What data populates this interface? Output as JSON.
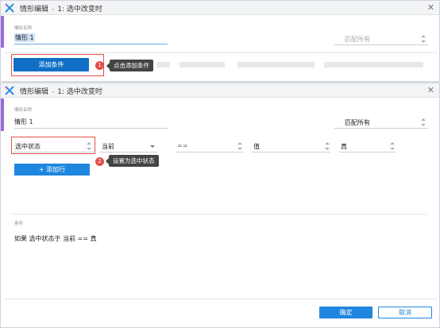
{
  "dialog1": {
    "title": "情形编辑",
    "title_sep": "-",
    "title_case": "1: 选中改变时",
    "name_label": "情形名称",
    "name_value": "情形 1",
    "match_value": "匹配所有",
    "add_condition_label": "添加条件",
    "step_badge": "1",
    "tooltip": "点击添加条件",
    "close_glyph": "✕"
  },
  "dialog2": {
    "title": "情形编辑",
    "title_sep": "-",
    "title_case": "1: 选中改变时",
    "name_label": "情形名称",
    "name_value": "情形 1",
    "match_value": "匹配所有",
    "close_glyph": "✕",
    "condition_row": {
      "field1": "选中状态",
      "field2": "当前",
      "operator": "==",
      "value_type": "值",
      "value": "真"
    },
    "step_badge": "2",
    "tooltip": "设置为选中状态",
    "add_row_label": "+ 添加行",
    "conditions_label": "条件",
    "conditions_text": "如果  选中状态于 当前 == 真",
    "ok_label": "确定",
    "cancel_label": "取消"
  },
  "colors": {
    "accent": "#9b6bdc",
    "primary": "#1f86e0",
    "highlight_red": "#e3504a",
    "tooltip_bg": "#444444"
  },
  "icons": [
    "axure-logo-icon",
    "close-icon",
    "spinner-icon",
    "dropdown-caret-icon"
  ]
}
